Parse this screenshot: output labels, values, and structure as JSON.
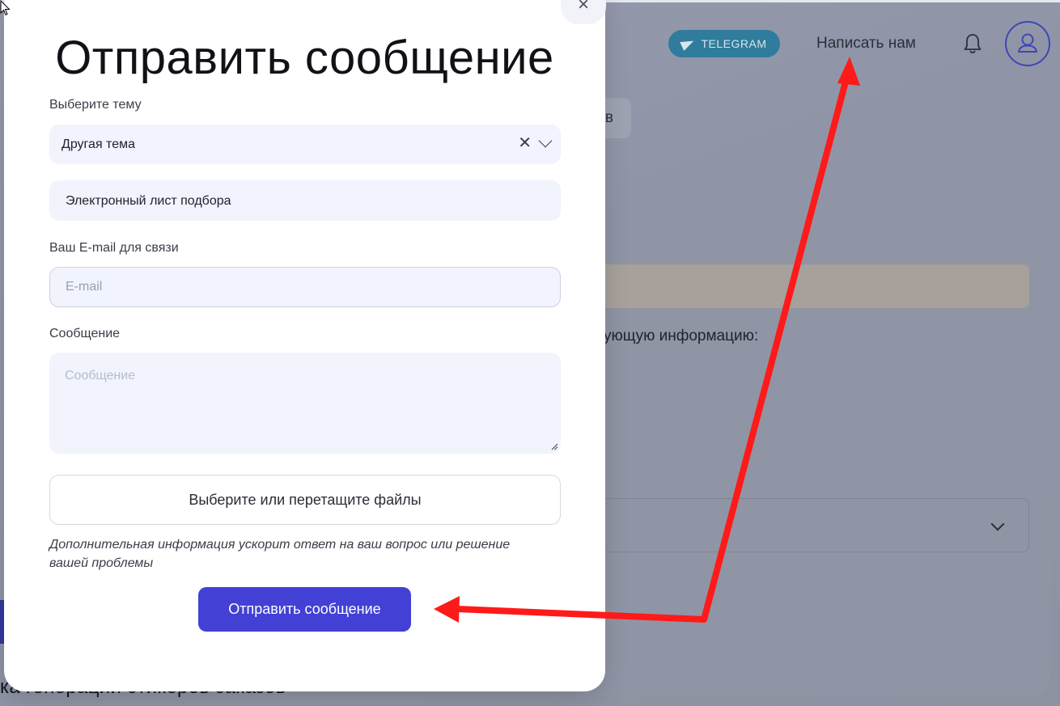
{
  "background": {
    "telegram_label": "TELEGRAM",
    "write_us_label": "Написать нам",
    "tab_fragment": "в",
    "info_text_fragment": "ующую информацию:",
    "bottom_text_fragment": "ка генерации стикеров заказов"
  },
  "modal": {
    "title": "Отправить сообщение",
    "close_icon": "×",
    "topic_label": "Выберите тему",
    "topic_value": "Другая тема",
    "subtopic_value": "Электронный лист подбора",
    "email_label": "Ваш E-mail для связи",
    "email_placeholder": "E-mail",
    "email_value": "",
    "message_label": "Сообщение",
    "message_placeholder": "Сообщение",
    "files_label": "Выберите или перетащите файлы",
    "hint": "Дополнительная информация ускорит ответ на ваш вопрос или решение вашей проблемы",
    "submit_label": "Отправить сообщение"
  },
  "colors": {
    "accent": "#4340d6",
    "field_bg": "#f1f3fd",
    "overlay": "#8e93a3",
    "annotation_arrow": "#ff1a1a"
  },
  "icons": [
    "telegram-icon",
    "bell-icon",
    "user-icon",
    "close-icon",
    "clear-icon",
    "chevron-down-icon",
    "resize-grip-icon",
    "cursor-icon"
  ]
}
